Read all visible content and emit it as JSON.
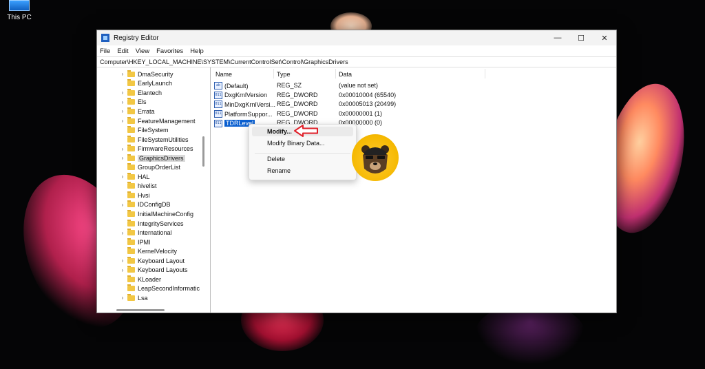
{
  "desktop": {
    "icon_label": "This PC"
  },
  "window": {
    "title": "Registry Editor",
    "controls": {
      "minimize": "—",
      "maximize": "☐",
      "close": "✕"
    }
  },
  "menu": [
    "File",
    "Edit",
    "View",
    "Favorites",
    "Help"
  ],
  "address": "Computer\\HKEY_LOCAL_MACHINE\\SYSTEM\\CurrentControlSet\\Control\\GraphicsDrivers",
  "tree": [
    {
      "label": "DmaSecurity",
      "expand": true
    },
    {
      "label": "EarlyLaunch",
      "expand": false
    },
    {
      "label": "Elantech",
      "expand": true
    },
    {
      "label": "Els",
      "expand": true
    },
    {
      "label": "Errata",
      "expand": true
    },
    {
      "label": "FeatureManagement",
      "expand": true
    },
    {
      "label": "FileSystem",
      "expand": false
    },
    {
      "label": "FileSystemUtilities",
      "expand": false
    },
    {
      "label": "FirmwareResources",
      "expand": true
    },
    {
      "label": "GraphicsDrivers",
      "expand": true,
      "selected": true
    },
    {
      "label": "GroupOrderList",
      "expand": false
    },
    {
      "label": "HAL",
      "expand": true
    },
    {
      "label": "hivelist",
      "expand": false
    },
    {
      "label": "Hvsi",
      "expand": false
    },
    {
      "label": "IDConfigDB",
      "expand": true
    },
    {
      "label": "InitialMachineConfig",
      "expand": false
    },
    {
      "label": "IntegrityServices",
      "expand": false
    },
    {
      "label": "International",
      "expand": true
    },
    {
      "label": "IPMI",
      "expand": false
    },
    {
      "label": "KernelVelocity",
      "expand": false
    },
    {
      "label": "Keyboard Layout",
      "expand": true
    },
    {
      "label": "Keyboard Layouts",
      "expand": true
    },
    {
      "label": "KLoader",
      "expand": false
    },
    {
      "label": "LeapSecondInformatic",
      "expand": false
    },
    {
      "label": "Lsa",
      "expand": true
    }
  ],
  "columns": {
    "name": "Name",
    "type": "Type",
    "data": "Data"
  },
  "values": [
    {
      "name": "(Default)",
      "type": "REG_SZ",
      "data": "(value not set)",
      "icon": "ab"
    },
    {
      "name": "DxgKrnlVersion",
      "type": "REG_DWORD",
      "data": "0x00010004 (65540)",
      "icon": "011"
    },
    {
      "name": "MinDxgKrnlVersi...",
      "type": "REG_DWORD",
      "data": "0x00005013 (20499)",
      "icon": "011"
    },
    {
      "name": "PlatformSuppor...",
      "type": "REG_DWORD",
      "data": "0x00000001 (1)",
      "icon": "011"
    },
    {
      "name": "TDRLevel",
      "type": "REG_DWORD",
      "data": "0x00000000 (0)",
      "icon": "011",
      "selected": true
    }
  ],
  "context_menu": {
    "modify": "Modify...",
    "modify_binary": "Modify Binary Data...",
    "delete": "Delete",
    "rename": "Rename"
  },
  "colors": {
    "selection": "#0a5fd0",
    "arrow": "#e0202a",
    "badge": "#f5b800"
  }
}
